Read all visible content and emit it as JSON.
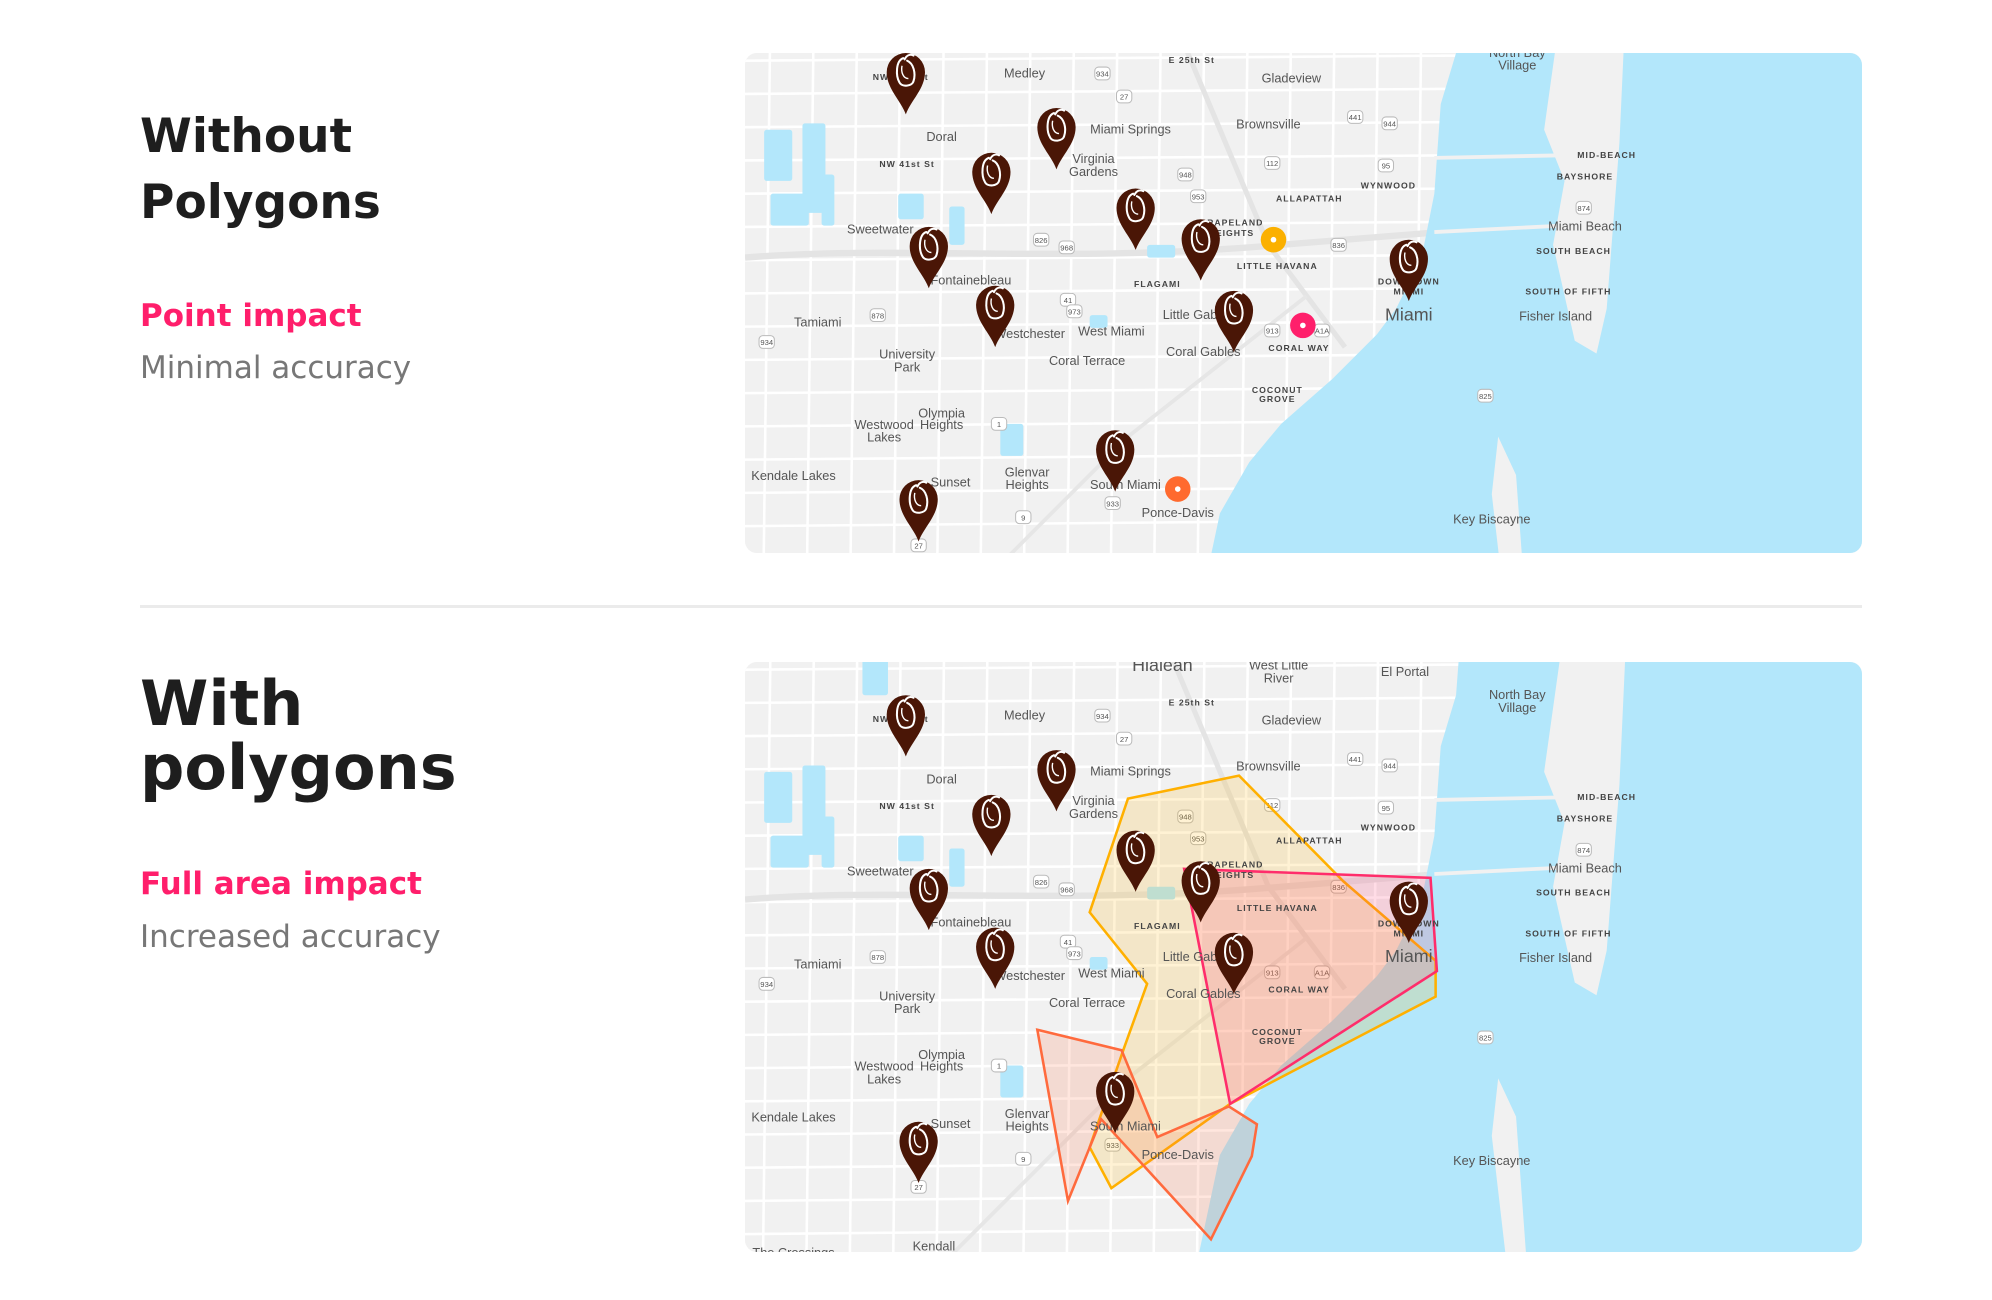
{
  "sections": [
    {
      "title": "Without Polygons",
      "impact": "Point impact",
      "accuracy": "Minimal accuracy"
    },
    {
      "title": "With polygons",
      "impact": "Full area impact",
      "accuracy": "Increased accuracy"
    }
  ],
  "colors": {
    "accent": "#ff1e6b",
    "pin": "#4a1606",
    "water": "#b3e7fb",
    "land": "#f1f1f1",
    "dot_yellow": "#fbb000",
    "dot_pink": "#ff1f6b",
    "dot_orange": "#ff6a2e",
    "polygon_yellow": "#ffb000",
    "polygon_pink": "#ff2d6b",
    "polygon_orange": "#ff6a3d"
  },
  "map": {
    "pin_icon": "pepper-map-pin-icon",
    "labels": [
      "Medley",
      "Gladeview",
      "Doral",
      "Miami Springs",
      "Brownsville",
      "Virginia",
      "Gardens",
      "ALLAPATTAH",
      "WYNWOOD",
      "MID-BEACH",
      "BAYSHORE",
      "Miami Beach",
      "SOUTH BEACH",
      "SOUTH OF FIFTH",
      "Fisher Island",
      "Sweetwater",
      "GRAPELAND",
      "HEIGHTS",
      "LITTLE HAVANA",
      "FLAGAMI",
      "Fontainebleau",
      "Tamiami",
      "Westchester",
      "West Miami",
      "Little Gables",
      "Coral Gables",
      "CORAL WAY",
      "Miami",
      "DOWNTOWN",
      "MIAMI",
      "University",
      "Park",
      "Coral Terrace",
      "COCONUT",
      "GROVE",
      "Olympia",
      "Heights",
      "Westwood",
      "Lakes",
      "Kendale Lakes",
      "Sunset",
      "Glenvar",
      "Heights",
      "South Miami",
      "Ponce-Davis",
      "Key Biscayne",
      "North Bay",
      "Village",
      "NW 74th St",
      "NW 41st St",
      "E 25th St"
    ],
    "extra_labels": [
      "Hialeah",
      "West Little",
      "River",
      "El Portal",
      "Kendall",
      "The Crossings"
    ],
    "road_shields": [
      "934",
      "27",
      "441",
      "944",
      "112",
      "95",
      "948",
      "953",
      "836",
      "826",
      "968",
      "41",
      "973",
      "878",
      "1",
      "9",
      "933",
      "913",
      "A1A",
      "825",
      "874"
    ]
  }
}
